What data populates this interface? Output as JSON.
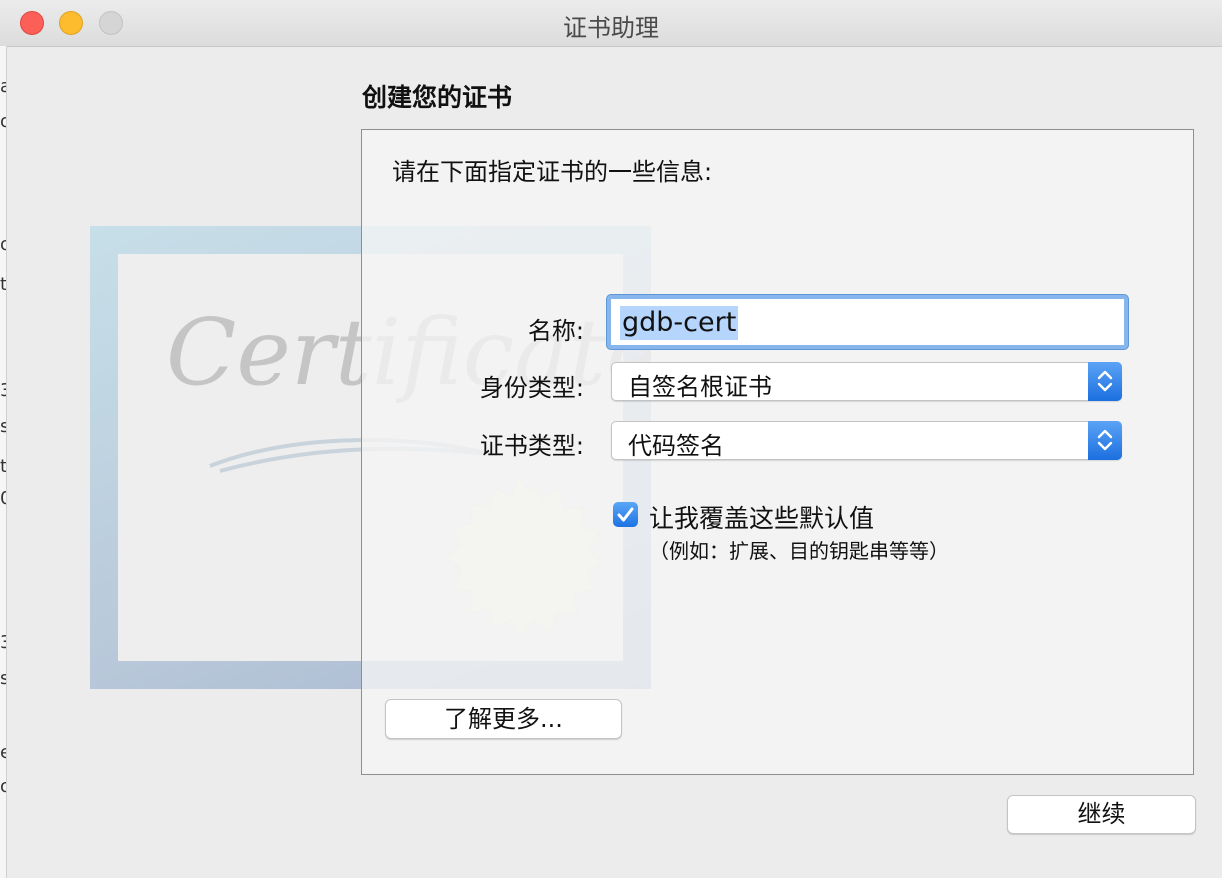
{
  "window": {
    "title": "证书助理"
  },
  "page": {
    "heading": "创建您的证书"
  },
  "form": {
    "prompt": "请在下面指定证书的一些信息:",
    "name_label": "名称:",
    "name_value": "gdb-cert",
    "identity_type_label": "身份类型:",
    "identity_type_value": "自签名根证书",
    "cert_type_label": "证书类型:",
    "cert_type_value": "代码签名",
    "override_label": "让我覆盖这些默认值",
    "override_note": "（例如：扩展、目的钥匙串等等）",
    "override_checked": true
  },
  "illustration": {
    "text": "Certificate"
  },
  "buttons": {
    "learn_more": "了解更多...",
    "continue": "继续"
  },
  "background_window": {
    "edge_chars": [
      "a",
      "o",
      "o",
      "t",
      "3",
      "s",
      "t",
      "0",
      "3",
      "s",
      "e",
      "o"
    ]
  },
  "colors": {
    "accent": "#1d72e3",
    "selection": "#b5d5fd",
    "focus_ring": "#86b6ec",
    "close": "#fc5f57",
    "minimize": "#fdbc2e",
    "zoom": "#d5d5d5"
  },
  "icons": [
    "close-button",
    "minimize-button",
    "zoom-button",
    "chevron-updown-icon",
    "checkmark-icon",
    "certificate-seal-icon"
  ]
}
